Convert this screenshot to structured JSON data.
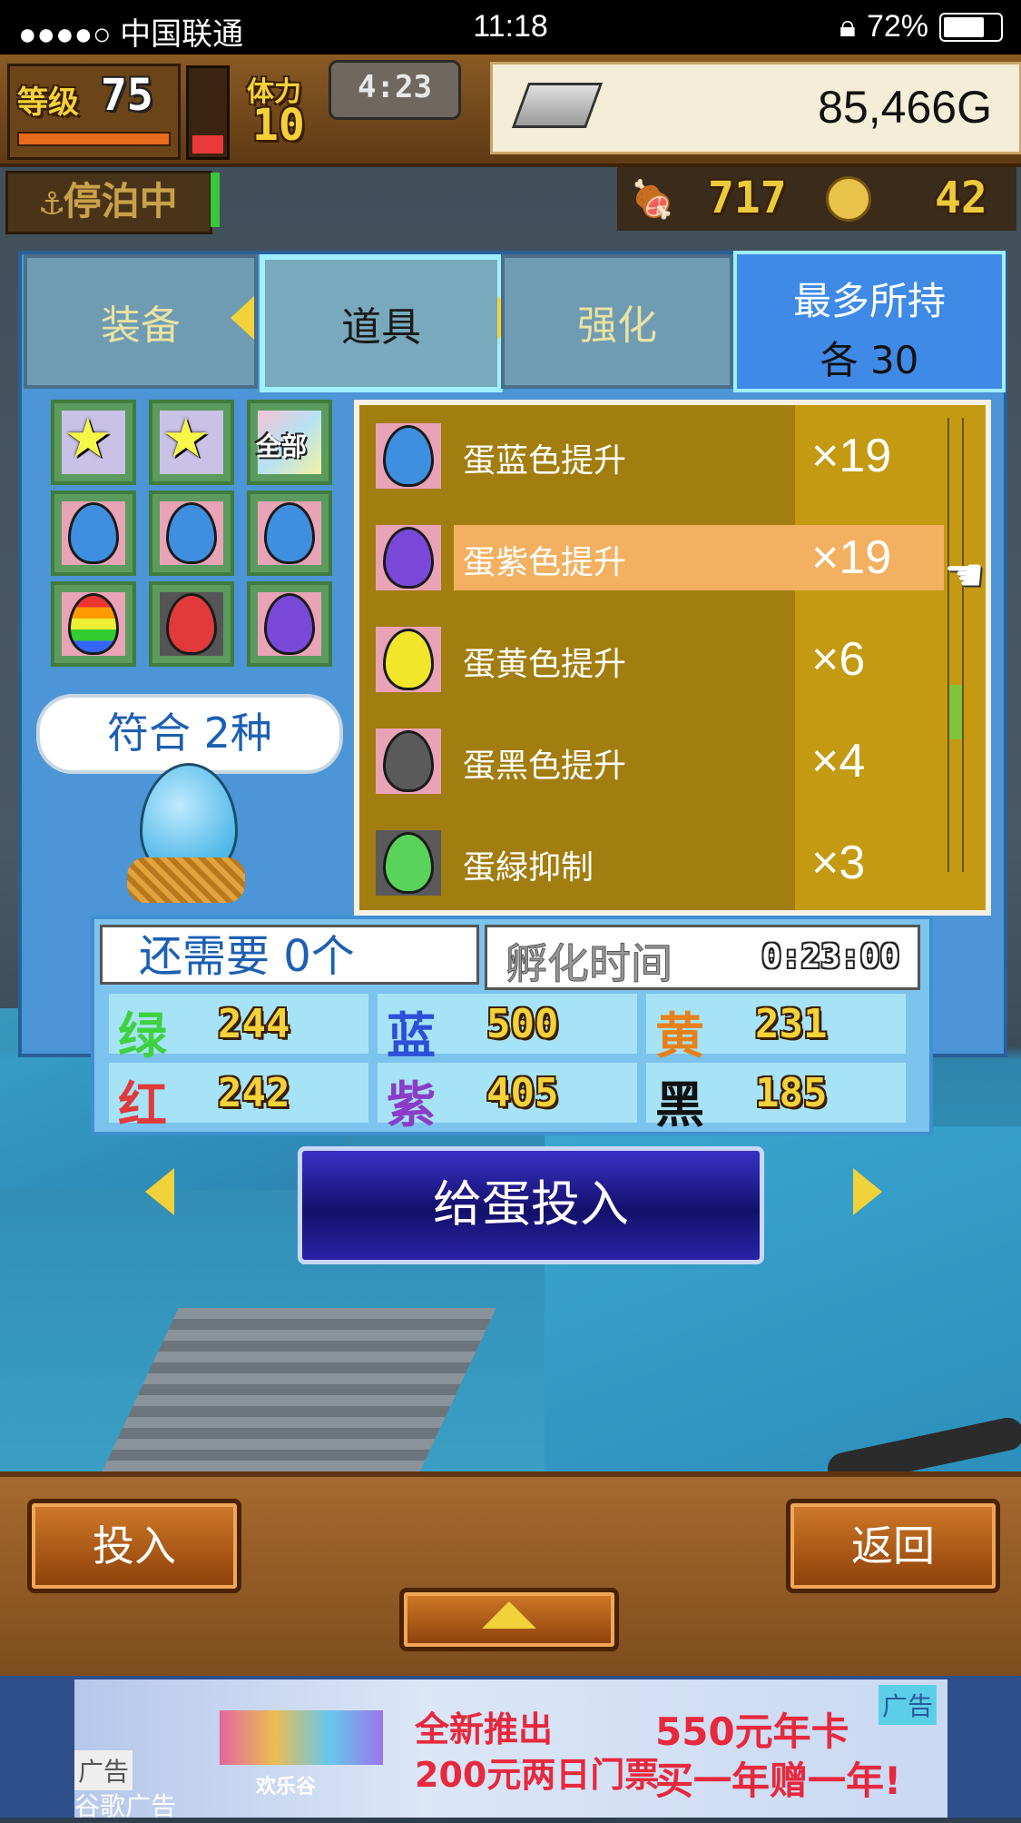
{
  "status_bar": {
    "carrier": "●●●●○ 中国联通",
    "time": "11:18",
    "battery": "72%"
  },
  "hud": {
    "level_label": "等级",
    "level": "75",
    "stamina_label": "体力",
    "stamina": "10",
    "timer": "4:23",
    "money": "85,466G",
    "moored": "停泊中",
    "food": "717",
    "medals": "42"
  },
  "tabs": [
    {
      "label": "装备"
    },
    {
      "label": "道具"
    },
    {
      "label": "强化"
    }
  ],
  "max_hold": {
    "line1": "最多所持",
    "line2": "各 30"
  },
  "filter_all_label": "全部",
  "items": [
    {
      "name": "蛋蓝色提升",
      "count": "×19",
      "egg_color": "#3f8fe0"
    },
    {
      "name": "蛋紫色提升",
      "count": "×19",
      "egg_color": "#7a48d8"
    },
    {
      "name": "蛋黄色提升",
      "count": "×6",
      "egg_color": "#f2e62a"
    },
    {
      "name": "蛋黑色提升",
      "count": "×4",
      "egg_color": "#5a5a5a"
    },
    {
      "name": "蛋緑抑制",
      "count": "×3",
      "egg_color": "#5ad35a"
    }
  ],
  "match_text": "符合 2种",
  "need_text": "还需要 0个",
  "hatch": {
    "label": "孵化时间",
    "value": "0:23:00"
  },
  "stats": [
    {
      "key": "绿",
      "value": "244",
      "color": "#3ed23e"
    },
    {
      "key": "蓝",
      "value": "500",
      "color": "#2b4fd6"
    },
    {
      "key": "黄",
      "value": "231",
      "color": "#e8801a"
    },
    {
      "key": "红",
      "value": "242",
      "color": "#e23a3a"
    },
    {
      "key": "紫",
      "value": "405",
      "color": "#8a3cc8"
    },
    {
      "key": "黑",
      "value": "185",
      "color": "#111111"
    }
  ],
  "main_button": "给蛋投入",
  "bottom": {
    "left_button": "投入",
    "right_button": "返回"
  },
  "ad": {
    "tag_top": "广告",
    "tag_bottom": "广告",
    "google": "谷歌广告",
    "brand": "欢乐谷",
    "line1": "全新推出",
    "line2": "200元两日门票",
    "line3": "550元年卡",
    "line4": "买一年赠一年!"
  }
}
